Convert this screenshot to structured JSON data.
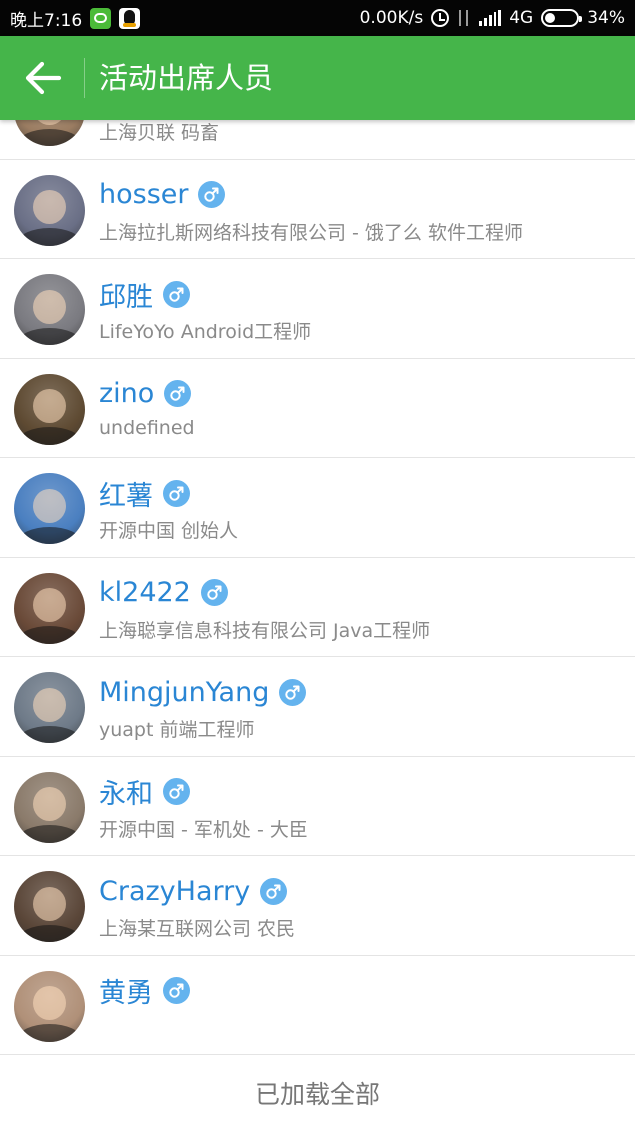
{
  "status_bar": {
    "time": "晚上7:16",
    "net_speed": "0.00K/s",
    "network": "4G",
    "battery": "34%",
    "battery_level": 0.34,
    "icons": [
      "wechat-icon",
      "qq-icon",
      "alarm-icon",
      "data-arrows-icon",
      "signal-icon",
      "battery-icon"
    ]
  },
  "header": {
    "back_icon": "arrow-left-icon",
    "title": "活动出席人员",
    "color": "#45b54a"
  },
  "attendees": [
    {
      "name": "",
      "desc": "上海贝联 码畜",
      "avatar_color": "#9b7d62",
      "gender_icon": "male-icon"
    },
    {
      "name": "hosser",
      "desc": "上海拉扎斯网络科技有限公司 - 饿了么 软件工程师",
      "avatar_color": "#6a6f86",
      "gender_icon": "male-icon"
    },
    {
      "name": "邱胜",
      "desc": "LifeYoYo Android工程师",
      "avatar_color": "#7a7a80",
      "gender_icon": "male-icon"
    },
    {
      "name": "zino",
      "desc": "undefined",
      "avatar_color": "#5e4a32",
      "gender_icon": "male-icon"
    },
    {
      "name": "红薯",
      "desc": "开源中国 创始人",
      "avatar_color": "#4a7fc0",
      "gender_icon": "male-icon"
    },
    {
      "name": "kl2422",
      "desc": "上海聪享信息科技有限公司 Java工程师",
      "avatar_color": "#6a4a38",
      "gender_icon": "male-icon"
    },
    {
      "name": "MingjunYang",
      "desc": "yuapt 前端工程师",
      "avatar_color": "#6e7a88",
      "gender_icon": "male-icon"
    },
    {
      "name": "永和",
      "desc": "开源中国 - 军机处 - 大臣",
      "avatar_color": "#8a7a6a",
      "gender_icon": "male-icon"
    },
    {
      "name": "CrazyHarry",
      "desc": "上海某互联网公司 农民",
      "avatar_color": "#5a4638",
      "gender_icon": "male-icon"
    },
    {
      "name": "黄勇",
      "desc": "",
      "avatar_color": "#b09078",
      "gender_icon": "male-icon"
    }
  ],
  "footer": {
    "text": "已加载全部"
  },
  "colors": {
    "name": "#2a86d4",
    "desc": "#8a8a8a",
    "gender_badge": "#64b3ee"
  }
}
